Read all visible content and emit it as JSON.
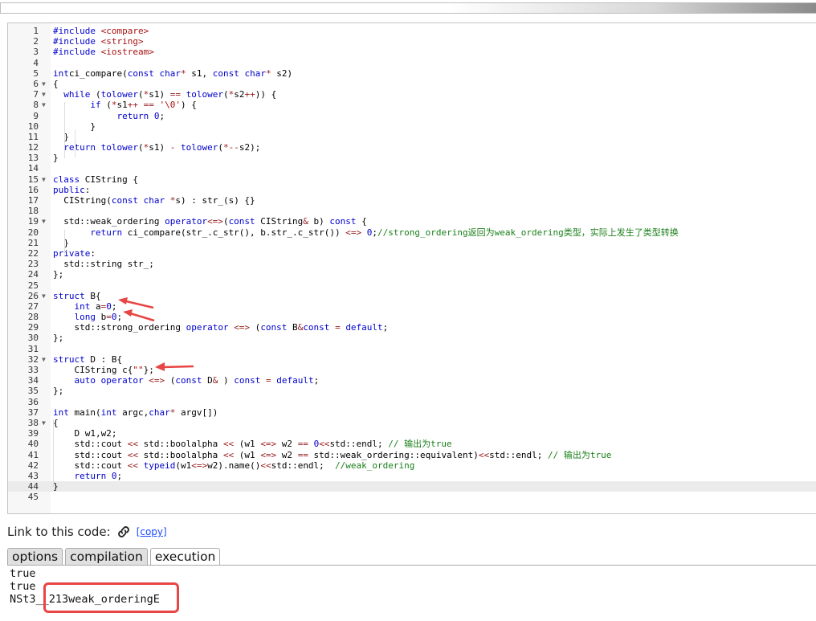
{
  "code": {
    "lines": [
      {
        "n": "1",
        "fold": false,
        "segs": [
          [
            "kw",
            "#include "
          ],
          [
            "str",
            "<compare>"
          ]
        ]
      },
      {
        "n": "2",
        "fold": false,
        "segs": [
          [
            "kw",
            "#include "
          ],
          [
            "str",
            "<string>"
          ]
        ]
      },
      {
        "n": "3",
        "fold": false,
        "segs": [
          [
            "kw",
            "#include "
          ],
          [
            "str",
            "<iostream>"
          ]
        ]
      },
      {
        "n": "4",
        "fold": false,
        "segs": []
      },
      {
        "n": "5",
        "fold": false,
        "segs": [
          [
            "kw",
            "int"
          ],
          [
            "",
            "ci_compare("
          ],
          [
            "kw",
            "const char"
          ],
          [
            "op",
            "*"
          ],
          [
            "",
            " s1, "
          ],
          [
            "kw",
            "const char"
          ],
          [
            "op",
            "*"
          ],
          [
            "",
            " s2)"
          ]
        ]
      },
      {
        "n": "6",
        "fold": true,
        "segs": [
          [
            "",
            "{"
          ]
        ]
      },
      {
        "n": "7",
        "fold": true,
        "segs": [
          [
            "",
            "  "
          ],
          [
            "kw",
            "while"
          ],
          [
            "",
            " ("
          ],
          [
            "kw",
            "tolower"
          ],
          [
            "",
            "("
          ],
          [
            "op",
            "*"
          ],
          [
            "",
            "s1) "
          ],
          [
            "op",
            "=="
          ],
          [
            "",
            " "
          ],
          [
            "kw",
            "tolower"
          ],
          [
            "",
            "("
          ],
          [
            "op",
            "*"
          ],
          [
            "",
            "s2"
          ],
          [
            "op",
            "++"
          ],
          [
            "",
            ")) {"
          ]
        ]
      },
      {
        "n": "8",
        "fold": true,
        "segs": [
          [
            "",
            "       "
          ],
          [
            "kw",
            "if"
          ],
          [
            "",
            " ("
          ],
          [
            "op",
            "*"
          ],
          [
            "",
            "s1"
          ],
          [
            "op",
            "++"
          ],
          [
            "",
            " "
          ],
          [
            "op",
            "=="
          ],
          [
            "",
            " "
          ],
          [
            "str",
            "'\\0'"
          ],
          [
            "",
            ") {"
          ]
        ]
      },
      {
        "n": "9",
        "fold": false,
        "segs": [
          [
            "",
            "            "
          ],
          [
            "kw",
            "return"
          ],
          [
            "",
            " "
          ],
          [
            "kw",
            "0"
          ],
          [
            "",
            ";"
          ]
        ]
      },
      {
        "n": "10",
        "fold": false,
        "segs": [
          [
            "",
            "       }"
          ]
        ]
      },
      {
        "n": "11",
        "fold": false,
        "segs": [
          [
            "",
            "  }"
          ]
        ]
      },
      {
        "n": "12",
        "fold": false,
        "segs": [
          [
            "",
            "  "
          ],
          [
            "kw",
            "return"
          ],
          [
            "",
            " "
          ],
          [
            "kw",
            "tolower"
          ],
          [
            "",
            "("
          ],
          [
            "op",
            "*"
          ],
          [
            "",
            "s1) "
          ],
          [
            "op",
            "-"
          ],
          [
            "",
            " "
          ],
          [
            "kw",
            "tolower"
          ],
          [
            "",
            "("
          ],
          [
            "op",
            "*--"
          ],
          [
            "",
            "s2);"
          ]
        ]
      },
      {
        "n": "13",
        "fold": false,
        "segs": [
          [
            "",
            "}"
          ]
        ]
      },
      {
        "n": "14",
        "fold": false,
        "segs": []
      },
      {
        "n": "15",
        "fold": true,
        "segs": [
          [
            "kw",
            "class"
          ],
          [
            "",
            " CIString {"
          ]
        ]
      },
      {
        "n": "16",
        "fold": false,
        "segs": [
          [
            "kw",
            "public"
          ],
          [
            "",
            ":"
          ]
        ]
      },
      {
        "n": "17",
        "fold": false,
        "segs": [
          [
            "",
            "  CIString("
          ],
          [
            "kw",
            "const char"
          ],
          [
            "",
            " "
          ],
          [
            "op",
            "*"
          ],
          [
            "",
            "s) : str_(s) {}"
          ]
        ]
      },
      {
        "n": "18",
        "fold": false,
        "segs": []
      },
      {
        "n": "19",
        "fold": true,
        "segs": [
          [
            "",
            "  std::weak_ordering "
          ],
          [
            "kw",
            "operator"
          ],
          [
            "op",
            "<=>"
          ],
          [
            "",
            "("
          ],
          [
            "kw",
            "const"
          ],
          [
            "",
            " CIString"
          ],
          [
            "op",
            "&"
          ],
          [
            "",
            " b) "
          ],
          [
            "kw",
            "const"
          ],
          [
            "",
            " {"
          ]
        ]
      },
      {
        "n": "20",
        "fold": false,
        "segs": [
          [
            "",
            "       "
          ],
          [
            "kw",
            "return"
          ],
          [
            "",
            " ci_compare(str_.c_str(), b.str_.c_str()) "
          ],
          [
            "op",
            "<=>"
          ],
          [
            "",
            " "
          ],
          [
            "kw",
            "0"
          ],
          [
            "",
            ";"
          ],
          [
            "cm",
            "//strong_ordering返回为weak_ordering类型，实际上发生了类型转换"
          ]
        ]
      },
      {
        "n": "21",
        "fold": false,
        "segs": [
          [
            "",
            "  }"
          ]
        ]
      },
      {
        "n": "22",
        "fold": false,
        "segs": [
          [
            "kw",
            "private"
          ],
          [
            "",
            ":"
          ]
        ]
      },
      {
        "n": "23",
        "fold": false,
        "segs": [
          [
            "",
            "  std::string str_;"
          ]
        ]
      },
      {
        "n": "24",
        "fold": false,
        "segs": [
          [
            "",
            "};"
          ]
        ]
      },
      {
        "n": "25",
        "fold": false,
        "segs": []
      },
      {
        "n": "26",
        "fold": true,
        "segs": [
          [
            "kw",
            "struct"
          ],
          [
            "",
            " B{"
          ]
        ]
      },
      {
        "n": "27",
        "fold": false,
        "segs": [
          [
            "",
            "    "
          ],
          [
            "kw",
            "int"
          ],
          [
            "",
            " a"
          ],
          [
            "op",
            "="
          ],
          [
            "kw",
            "0"
          ],
          [
            "",
            ";"
          ]
        ]
      },
      {
        "n": "28",
        "fold": false,
        "segs": [
          [
            "",
            "    "
          ],
          [
            "kw",
            "long"
          ],
          [
            "",
            " b"
          ],
          [
            "op",
            "="
          ],
          [
            "kw",
            "0"
          ],
          [
            "",
            ";"
          ]
        ]
      },
      {
        "n": "29",
        "fold": false,
        "segs": [
          [
            "",
            "    std::strong_ordering "
          ],
          [
            "kw",
            "operator"
          ],
          [
            "",
            " "
          ],
          [
            "op",
            "<=>"
          ],
          [
            "",
            " ("
          ],
          [
            "kw",
            "const"
          ],
          [
            "",
            " B"
          ],
          [
            "op",
            "&"
          ],
          [
            ") "
          ],
          [
            "kw",
            "const"
          ],
          [
            "",
            " "
          ],
          [
            "op",
            "="
          ],
          [
            "",
            " "
          ],
          [
            "kw",
            "default"
          ],
          [
            "",
            ";"
          ]
        ]
      },
      {
        "n": "30",
        "fold": false,
        "segs": [
          [
            "",
            "};"
          ]
        ]
      },
      {
        "n": "31",
        "fold": false,
        "segs": []
      },
      {
        "n": "32",
        "fold": true,
        "segs": [
          [
            "kw",
            "struct"
          ],
          [
            "",
            " D : B{"
          ]
        ]
      },
      {
        "n": "33",
        "fold": false,
        "segs": [
          [
            "",
            "    CIString c{"
          ],
          [
            "str",
            "\"\""
          ],
          [
            "",
            "};"
          ]
        ]
      },
      {
        "n": "34",
        "fold": false,
        "segs": [
          [
            "",
            "    "
          ],
          [
            "kw",
            "auto"
          ],
          [
            "",
            " "
          ],
          [
            "kw",
            "operator"
          ],
          [
            "",
            " "
          ],
          [
            "op",
            "<=>"
          ],
          [
            "",
            " ("
          ],
          [
            "kw",
            "const"
          ],
          [
            "",
            " D"
          ],
          [
            "op",
            "&"
          ],
          [
            "",
            " ) "
          ],
          [
            "kw",
            "const"
          ],
          [
            "",
            " "
          ],
          [
            "op",
            "="
          ],
          [
            "",
            " "
          ],
          [
            "kw",
            "default"
          ],
          [
            "",
            ";"
          ]
        ]
      },
      {
        "n": "35",
        "fold": false,
        "segs": [
          [
            "",
            "};"
          ]
        ]
      },
      {
        "n": "36",
        "fold": false,
        "segs": []
      },
      {
        "n": "37",
        "fold": false,
        "segs": [
          [
            "kw",
            "int"
          ],
          [
            "",
            " main("
          ],
          [
            "kw",
            "int"
          ],
          [
            "",
            " argc,"
          ],
          [
            "kw",
            "char"
          ],
          [
            "op",
            "*"
          ],
          [
            "",
            " argv[])"
          ]
        ]
      },
      {
        "n": "38",
        "fold": true,
        "segs": [
          [
            "",
            "{"
          ]
        ]
      },
      {
        "n": "39",
        "fold": false,
        "segs": [
          [
            "",
            "    D w1,w2;"
          ]
        ]
      },
      {
        "n": "40",
        "fold": false,
        "segs": [
          [
            "",
            "    std::cout "
          ],
          [
            "op",
            "<<"
          ],
          [
            "",
            " std::boolalpha "
          ],
          [
            "op",
            "<<"
          ],
          [
            "",
            " (w1 "
          ],
          [
            "op",
            "<=>"
          ],
          [
            "",
            " w2 "
          ],
          [
            "op",
            "=="
          ],
          [
            "",
            " "
          ],
          [
            "kw",
            "0"
          ],
          [
            ")"
          ],
          [
            "op",
            "<<"
          ],
          [
            "",
            "std::endl; "
          ],
          [
            "cm",
            "// 输出为true"
          ]
        ]
      },
      {
        "n": "41",
        "fold": false,
        "segs": [
          [
            "",
            "    std::cout "
          ],
          [
            "op",
            "<<"
          ],
          [
            "",
            " std::boolalpha "
          ],
          [
            "op",
            "<<"
          ],
          [
            "",
            " (w1 "
          ],
          [
            "op",
            "<=>"
          ],
          [
            "",
            " w2 "
          ],
          [
            "op",
            "=="
          ],
          [
            "",
            " std::weak_ordering::equivalent)"
          ],
          [
            "op",
            "<<"
          ],
          [
            "",
            "std::endl; "
          ],
          [
            "cm",
            "// 输出为true"
          ]
        ]
      },
      {
        "n": "42",
        "fold": false,
        "segs": [
          [
            "",
            "    std::cout "
          ],
          [
            "op",
            "<<"
          ],
          [
            "",
            " "
          ],
          [
            "kw",
            "typeid"
          ],
          [
            "",
            "(w1"
          ],
          [
            "op",
            "<=>"
          ],
          [
            "",
            "w2).name()"
          ],
          [
            "op",
            "<<"
          ],
          [
            "",
            "std::endl;  "
          ],
          [
            "cm",
            "//weak_ordering"
          ]
        ]
      },
      {
        "n": "43",
        "fold": false,
        "segs": [
          [
            "",
            "    "
          ],
          [
            "kw",
            "return"
          ],
          [
            "",
            " "
          ],
          [
            "kw",
            "0"
          ],
          [
            "",
            ";"
          ]
        ]
      },
      {
        "n": "44",
        "fold": false,
        "active": true,
        "segs": [
          [
            "",
            "}"
          ]
        ]
      },
      {
        "n": "45",
        "fold": false,
        "segs": []
      }
    ]
  },
  "link": {
    "label": "Link to this code:",
    "copy": "[copy]"
  },
  "tabs": [
    {
      "label": "options",
      "active": false
    },
    {
      "label": "compilation",
      "active": false
    },
    {
      "label": "execution",
      "active": true
    }
  ],
  "output": {
    "lines": [
      "true",
      "true",
      "NSt3__213weak_orderingE"
    ]
  },
  "colors": {
    "annotation": "#e84545",
    "keyword": "#0000cc",
    "comment": "#1a7f1a",
    "string": "#a11"
  }
}
